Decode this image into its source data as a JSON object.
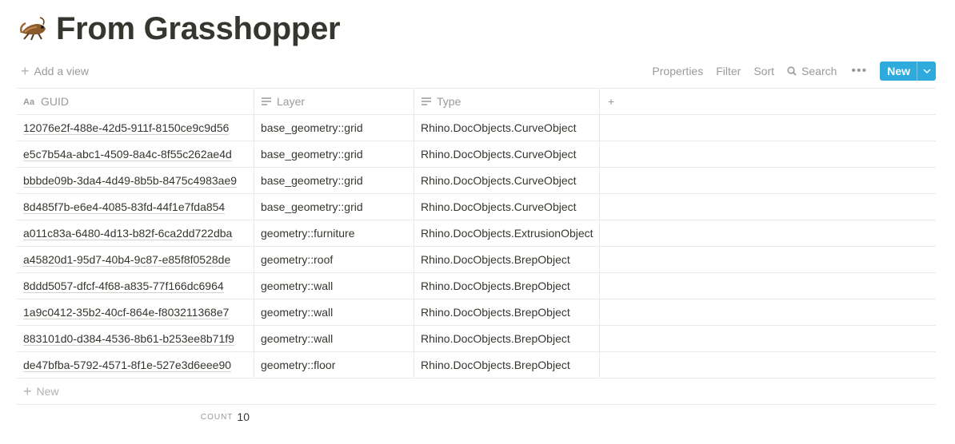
{
  "page": {
    "title": "From Grasshopper",
    "icon": "grasshopper-emoji"
  },
  "toolbar": {
    "add_view": "Add a view",
    "properties": "Properties",
    "filter": "Filter",
    "sort": "Sort",
    "search": "Search",
    "more": "•••",
    "new": "New"
  },
  "table": {
    "columns": [
      {
        "label": "GUID",
        "icon": "title-text-icon"
      },
      {
        "label": "Layer",
        "icon": "text-lines-icon"
      },
      {
        "label": "Type",
        "icon": "text-lines-icon"
      }
    ],
    "add_column": "+",
    "rows": [
      {
        "guid": "12076e2f-488e-42d5-911f-8150ce9c9d56",
        "layer": "base_geometry::grid",
        "type": "Rhino.DocObjects.CurveObject"
      },
      {
        "guid": "e5c7b54a-abc1-4509-8a4c-8f55c262ae4d",
        "layer": "base_geometry::grid",
        "type": "Rhino.DocObjects.CurveObject"
      },
      {
        "guid": "bbbde09b-3da4-4d49-8b5b-8475c4983ae9",
        "layer": "base_geometry::grid",
        "type": "Rhino.DocObjects.CurveObject"
      },
      {
        "guid": "8d485f7b-e6e4-4085-83fd-44f1e7fda854",
        "layer": "base_geometry::grid",
        "type": "Rhino.DocObjects.CurveObject"
      },
      {
        "guid": "a011c83a-6480-4d13-b82f-6ca2dd722dba",
        "layer": "geometry::furniture",
        "type": "Rhino.DocObjects.ExtrusionObject"
      },
      {
        "guid": "a45820d1-95d7-40b4-9c87-e85f8f0528de",
        "layer": "geometry::roof",
        "type": "Rhino.DocObjects.BrepObject"
      },
      {
        "guid": "8ddd5057-dfcf-4f68-a835-77f166dc6964",
        "layer": "geometry::wall",
        "type": "Rhino.DocObjects.BrepObject"
      },
      {
        "guid": "1a9c0412-35b2-40cf-864e-f803211368e7",
        "layer": "geometry::wall",
        "type": "Rhino.DocObjects.BrepObject"
      },
      {
        "guid": "883101d0-d384-4536-8b61-b253ee8b71f9",
        "layer": "geometry::wall",
        "type": "Rhino.DocObjects.BrepObject"
      },
      {
        "guid": "de47bfba-5792-4571-8f1e-527e3d6eee90",
        "layer": "geometry::floor",
        "type": "Rhino.DocObjects.BrepObject"
      }
    ],
    "new_row": "New",
    "count_label": "COUNT",
    "count_value": "10"
  },
  "colors": {
    "accent": "#2eaadc",
    "text": "#37352f",
    "muted": "#9b9a97",
    "border": "#e9e9e7"
  }
}
